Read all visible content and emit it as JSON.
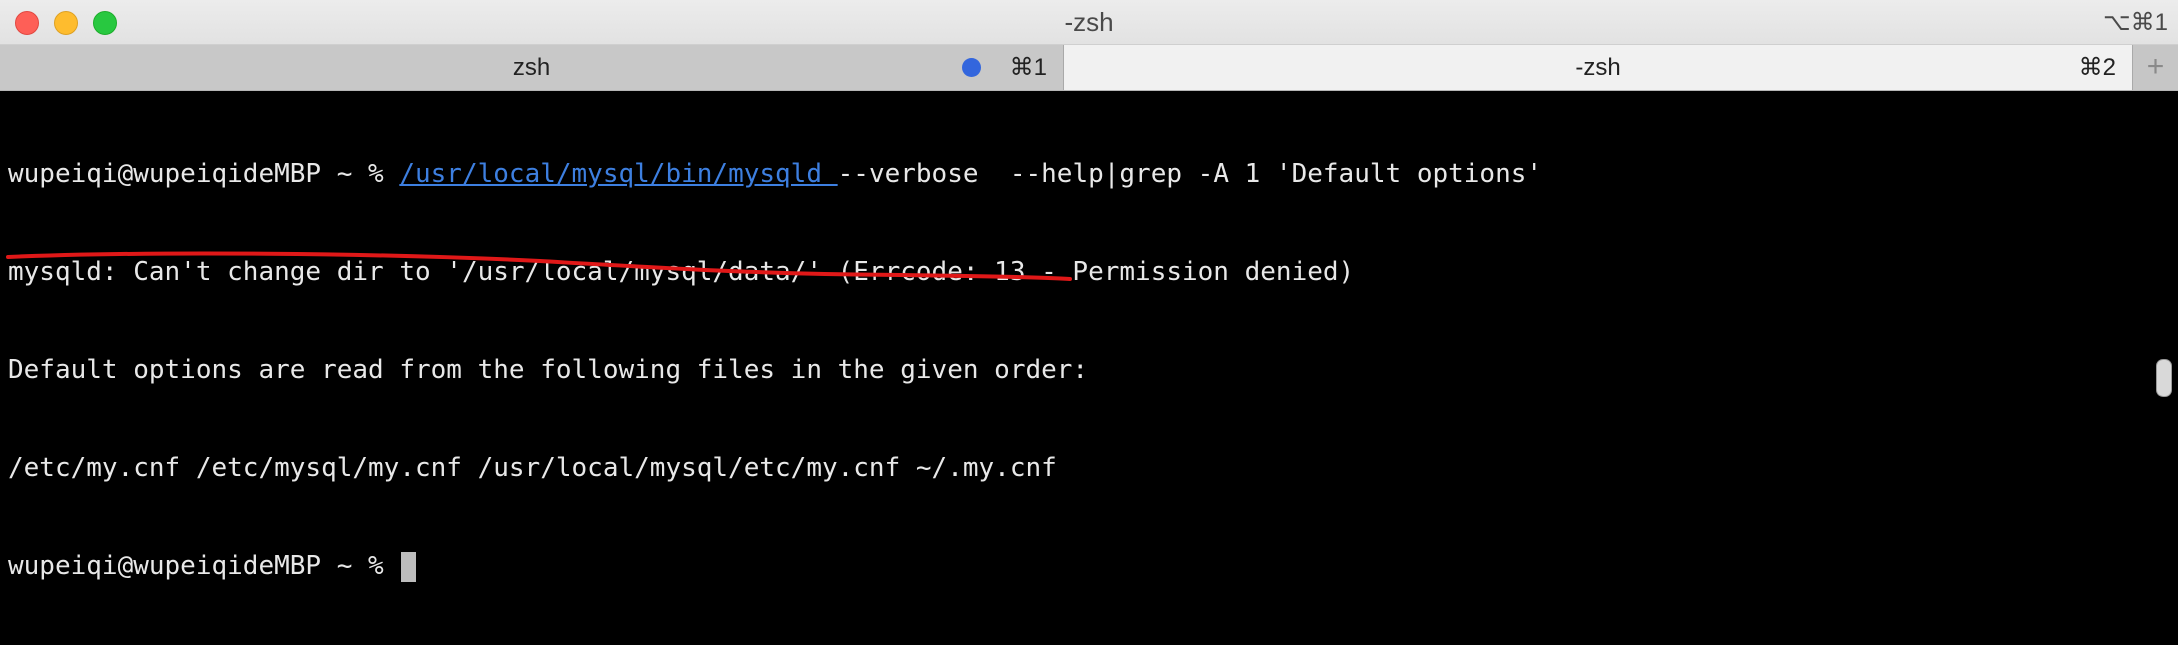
{
  "window": {
    "title": "-zsh",
    "title_shortcut": "⌥⌘1"
  },
  "tabs": [
    {
      "label": "zsh",
      "shortcut": "⌘1",
      "active": false,
      "has_activity": true
    },
    {
      "label": "-zsh",
      "shortcut": "⌘2",
      "active": true,
      "has_activity": false
    }
  ],
  "new_tab_icon": "+",
  "terminal": {
    "prompt": "wupeiqi@wupeiqideMBP ~ % ",
    "command_path": "/usr/local/mysql/bin/mysqld ",
    "command_args": "--verbose  --help|grep -A 1 'Default options'",
    "output": [
      "mysqld: Can't change dir to '/usr/local/mysql/data/' (Errcode: 13 - Permission denied)",
      "Default options are read from the following files in the given order:",
      "/etc/my.cnf /etc/mysql/my.cnf /usr/local/mysql/etc/my.cnf ~/.my.cnf"
    ],
    "current_prompt": "wupeiqi@wupeiqideMBP ~ % "
  },
  "colors": {
    "link": "#3d7fe0",
    "annotation": "#e01818",
    "activity_dot": "#3366dd"
  }
}
